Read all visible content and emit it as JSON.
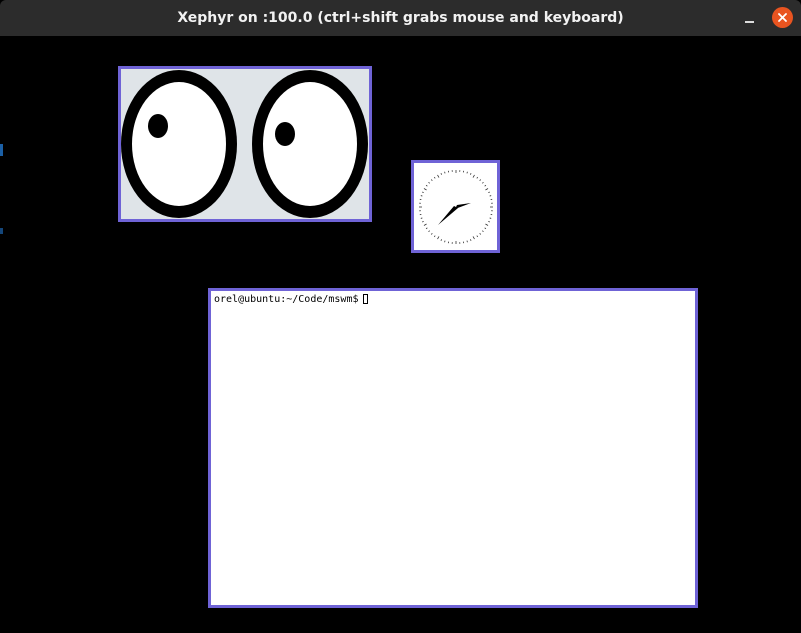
{
  "window": {
    "title": "Xephyr on :100.0 (ctrl+shift grabs mouse and keyboard)",
    "accent_color": "#e95420",
    "titlebar_color": "#2c2c2c"
  },
  "titlebar_buttons": {
    "minimize_icon": "minimize-icon",
    "close_icon": "close-icon"
  },
  "display": {
    "background": "#000000",
    "window_border_color": "#6f63d6"
  },
  "xeyes": {
    "icon": "eyes-icon",
    "background": "#dfe4e8"
  },
  "xclock": {
    "icon": "analog-clock-icon"
  },
  "xterm": {
    "prompt": "orel@ubuntu:~/Code/mswm$"
  }
}
